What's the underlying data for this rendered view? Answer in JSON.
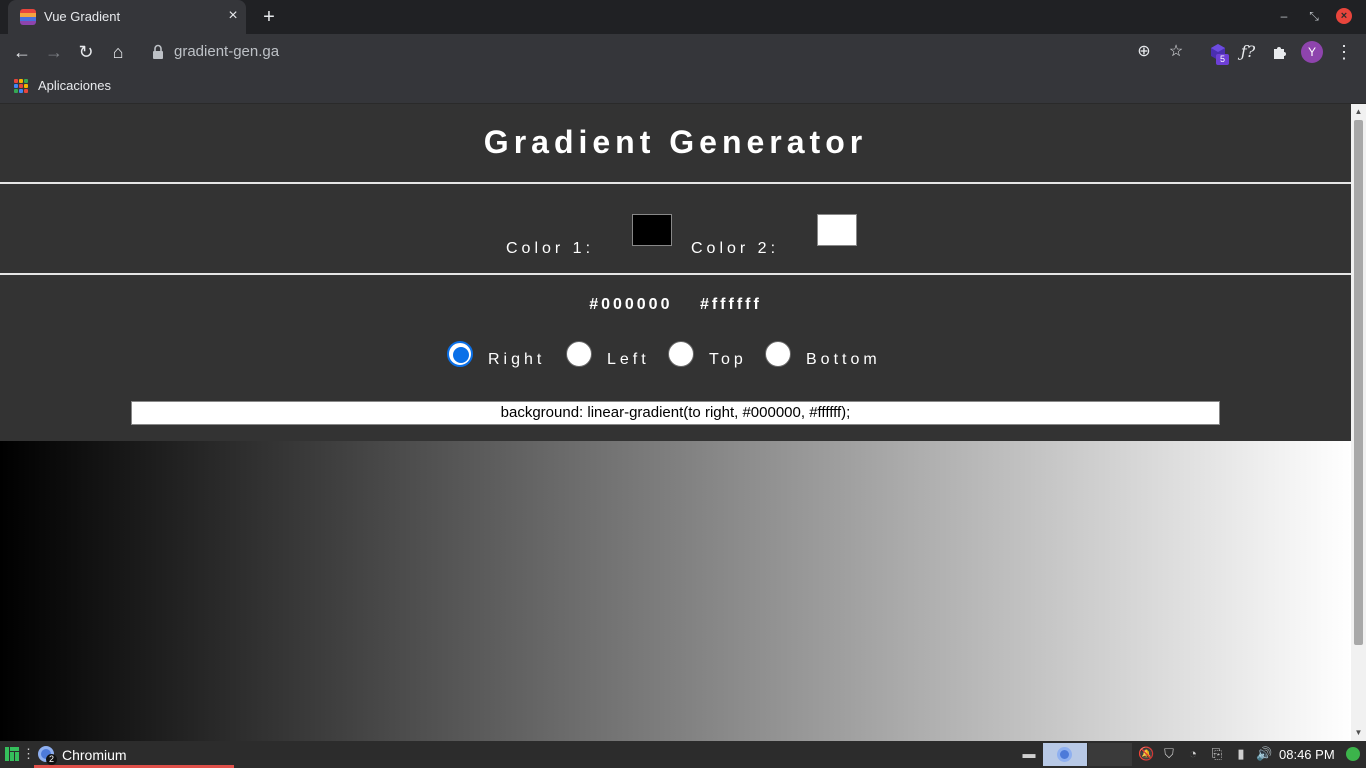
{
  "browser": {
    "tab_title": "Vue Gradient",
    "tab_close": "×",
    "new_tab": "+",
    "url": "gradient-gen.ga",
    "avatar_initial": "Y",
    "extension_badge": "5",
    "bookmarks_apps_label": "Aplicaciones"
  },
  "page": {
    "title": "Gradient Generator",
    "color1_label": "Color 1:",
    "color2_label": "Color 2:",
    "color1_value": "#000000",
    "color2_value": "#ffffff",
    "hex1": "#000000",
    "hex2": "#ffffff",
    "directions": [
      {
        "label": "Right",
        "checked": true
      },
      {
        "label": "Left",
        "checked": false
      },
      {
        "label": "Top",
        "checked": false
      },
      {
        "label": "Bottom",
        "checked": false
      }
    ],
    "css_output": "background: linear-gradient(to right, #000000, #ffffff);"
  },
  "taskbar": {
    "app_label": "Chromium",
    "app_count": "2",
    "clock": "08:46 PM"
  },
  "colors": {
    "accent_radio": "#0a70e8",
    "page_bg": "#333333",
    "taskbar_underline": "#e0504a"
  }
}
